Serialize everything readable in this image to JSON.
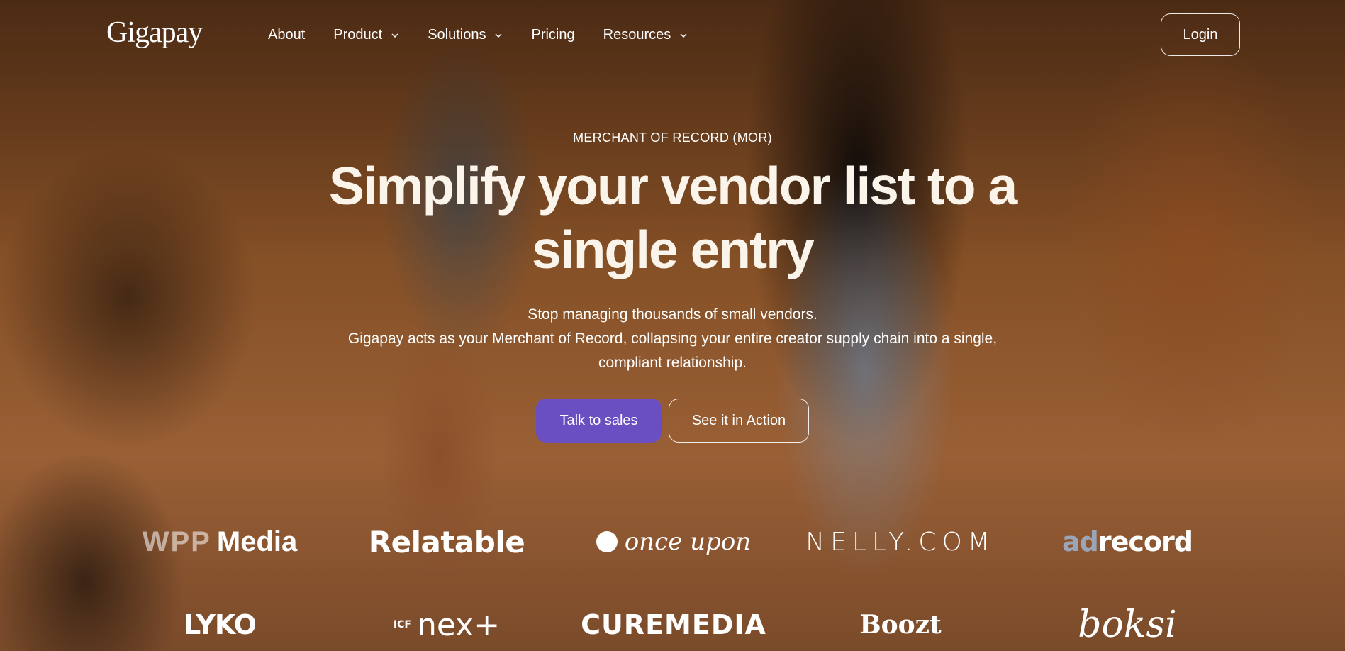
{
  "header": {
    "logo": "Gigapay",
    "nav": [
      {
        "label": "About",
        "has_dropdown": false
      },
      {
        "label": "Product",
        "has_dropdown": true
      },
      {
        "label": "Solutions",
        "has_dropdown": true
      },
      {
        "label": "Pricing",
        "has_dropdown": false
      },
      {
        "label": "Resources",
        "has_dropdown": true
      }
    ],
    "login_label": "Login"
  },
  "hero": {
    "eyebrow": "MERCHANT OF RECORD (MOR)",
    "headline": "Simplify your vendor list to a single entry",
    "sub_line_1": "Stop managing thousands of small vendors.",
    "sub_line_2": "Gigapay acts as your Merchant of Record, collapsing your entire creator supply chain into a single, compliant relationship.",
    "primary_cta": "Talk to sales",
    "secondary_cta": "See it in Action"
  },
  "logos": {
    "row1": {
      "wpp_part1": "WPP",
      "wpp_part2": "Media",
      "relatable": "Relatable",
      "onceupon": "once upon",
      "nelly": "NELLY.COM",
      "adrecord_part1": "ad",
      "adrecord_part2": "record"
    },
    "row2": {
      "lyko": "LYKO",
      "icf_part1": "ICF",
      "icf_part2": "nex+",
      "curemedia": "CUREMEDIA",
      "boozt": "Boozt",
      "boksi": "boksi"
    }
  },
  "colors": {
    "primary_button": "#6a4fc3",
    "text": "#ffffff"
  }
}
